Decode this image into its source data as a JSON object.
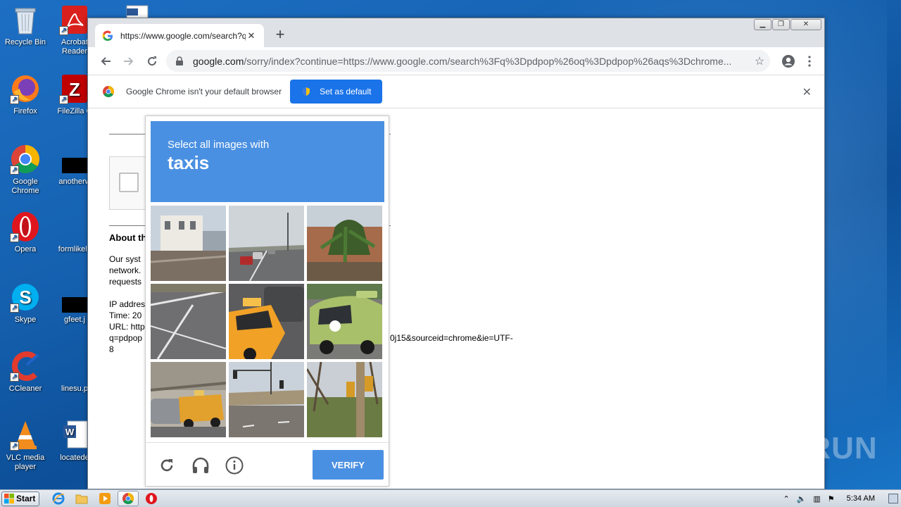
{
  "desktop": {
    "icons": [
      {
        "label": "Recycle Bin"
      },
      {
        "label": "Acrobat Reader"
      },
      {
        "label": "Firefox"
      },
      {
        "label": "FileZilla C"
      },
      {
        "label": "Google Chrome"
      },
      {
        "label": "anotherw"
      },
      {
        "label": "Opera"
      },
      {
        "label": "formlikely"
      },
      {
        "label": "Skype"
      },
      {
        "label": "gfeet.j"
      },
      {
        "label": "CCleaner"
      },
      {
        "label": "linesu.p"
      },
      {
        "label": "VLC media player"
      },
      {
        "label": "locatede"
      }
    ],
    "watermark": "ANY RUN"
  },
  "browser": {
    "tab_title": "https://www.google.com/search?q=",
    "tab_close": "✕",
    "new_tab": "+",
    "url_host": "google.com",
    "url_rest": "/sorry/index?continue=https://www.google.com/search%3Fq%3Dpdpop%26oq%3Dpdpop%26aqs%3Dchrome...",
    "infobar_text": "Google Chrome isn't your default browser",
    "set_default_label": "Set as default"
  },
  "page": {
    "about_heading": "About th",
    "para1": [
      "Our syst",
      "network.",
      "requests"
    ],
    "ip_lines": [
      "IP addres",
      "Time: 20",
      "URL: http",
      "q=pdpop",
      "8"
    ],
    "url_tail": "0j15&sourceid=chrome&ie=UTF-"
  },
  "captcha": {
    "instruction": "Select all images with",
    "target": "taxis",
    "verify_label": "VERIFY"
  },
  "taskbar": {
    "start_label": "Start",
    "clock": "5:34 AM"
  }
}
